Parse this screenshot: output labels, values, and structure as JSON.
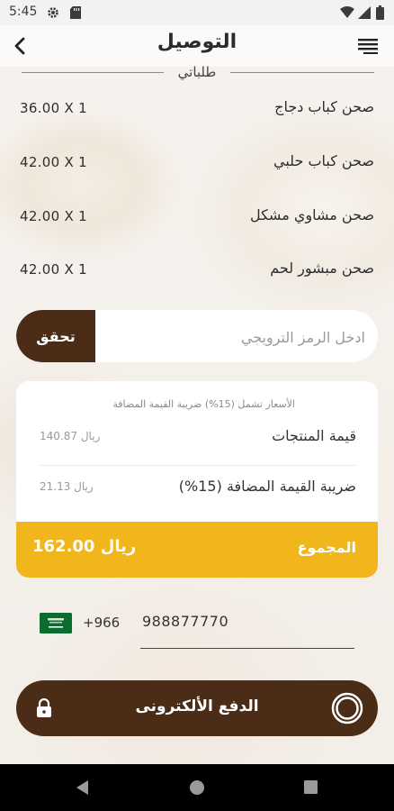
{
  "status_bar": {
    "time": "5:45",
    "icons": [
      "gear-icon",
      "sd-card-icon",
      "wifi-icon",
      "signal-icon",
      "battery-icon"
    ]
  },
  "header": {
    "title": "التوصيل",
    "back_icon": "chevron-left-icon",
    "menu_icon": "menu-lines-icon"
  },
  "orders": {
    "section_title": "طلباتي",
    "items": [
      {
        "name": "صحن كباب دجاج",
        "qty_price": "36.00 X 1"
      },
      {
        "name": "صحن كباب حلبي",
        "qty_price": "42.00 X 1"
      },
      {
        "name": "صحن مشاوي مشكل",
        "qty_price": "42.00 X 1"
      },
      {
        "name": "صحن مبشور لحم",
        "qty_price": "42.00 X 1"
      }
    ]
  },
  "coupon": {
    "placeholder": "ادخل الرمز الترويجي",
    "value": "",
    "verify_label": "تحقق"
  },
  "summary": {
    "vat_note": "الأسعار تشمل (15%) ضريبة القيمة المضافة",
    "products_label": "قيمة المنتجات",
    "products_value": "140.87 ريال",
    "vat_label": "ضريبة القيمة المضافة (15%)",
    "vat_value": "21.13 ريال",
    "total_label": "المجموع",
    "total_value": "162.00 ريال"
  },
  "phone": {
    "country_flag": "saudi-flag-icon",
    "dial_code": "+966",
    "number": "988877770"
  },
  "payment": {
    "label": "الدفع الألكترونى",
    "lock_icon": "lock-icon",
    "radio_icon": "radio-selected-icon"
  },
  "nav": {
    "icons": [
      "back-triangle-icon",
      "home-circle-icon",
      "recents-square-icon"
    ]
  },
  "colors": {
    "brand_brown": "#4b2c17",
    "accent_yellow": "#f0b61c"
  }
}
